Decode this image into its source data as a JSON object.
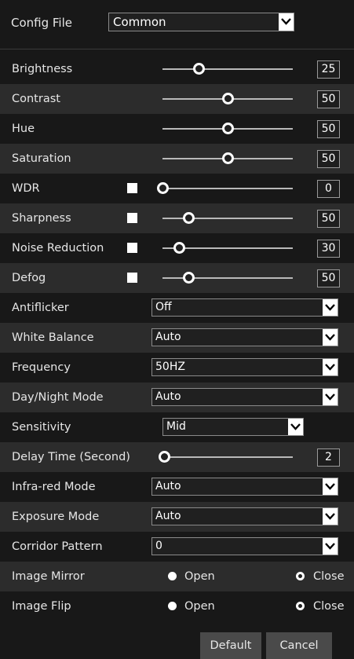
{
  "config": {
    "label": "Config File",
    "value": "Common"
  },
  "sliders": [
    {
      "label": "Brightness",
      "value": "25",
      "level": 0.28
    },
    {
      "label": "Contrast",
      "value": "50",
      "level": 0.5
    },
    {
      "label": "Hue",
      "value": "50",
      "level": 0.5
    },
    {
      "label": "Saturation",
      "value": "50",
      "level": 0.5
    },
    {
      "label": "WDR",
      "value": "0",
      "level": 0.0
    },
    {
      "label": "Sharpness",
      "value": "50",
      "level": 0.2
    },
    {
      "label": "Noise Reduction",
      "value": "30",
      "level": 0.13
    },
    {
      "label": "Defog",
      "value": "50",
      "level": 0.2
    }
  ],
  "dropdowns": [
    {
      "label": "Antiflicker",
      "value": "Off"
    },
    {
      "label": "White Balance",
      "value": "Auto"
    },
    {
      "label": "Frequency",
      "value": "50HZ"
    },
    {
      "label": "Day/Night Mode",
      "value": "Auto"
    },
    {
      "label": "Sensitivity",
      "value": "Mid"
    }
  ],
  "delay": {
    "label": "Delay Time (Second)",
    "value": "2",
    "level": 0.0
  },
  "dropdowns2": [
    {
      "label": "Infra-red Mode",
      "value": "Auto"
    },
    {
      "label": "Exposure Mode",
      "value": "Auto"
    },
    {
      "label": "Corridor Pattern",
      "value": "0"
    }
  ],
  "mirror": {
    "label": "Image Mirror",
    "open": "Open",
    "close": "Close",
    "selected": "Close"
  },
  "flip": {
    "label": "Image Flip",
    "open": "Open",
    "close": "Close",
    "selected": "Close"
  },
  "buttons": {
    "default": "Default",
    "cancel": "Cancel"
  }
}
